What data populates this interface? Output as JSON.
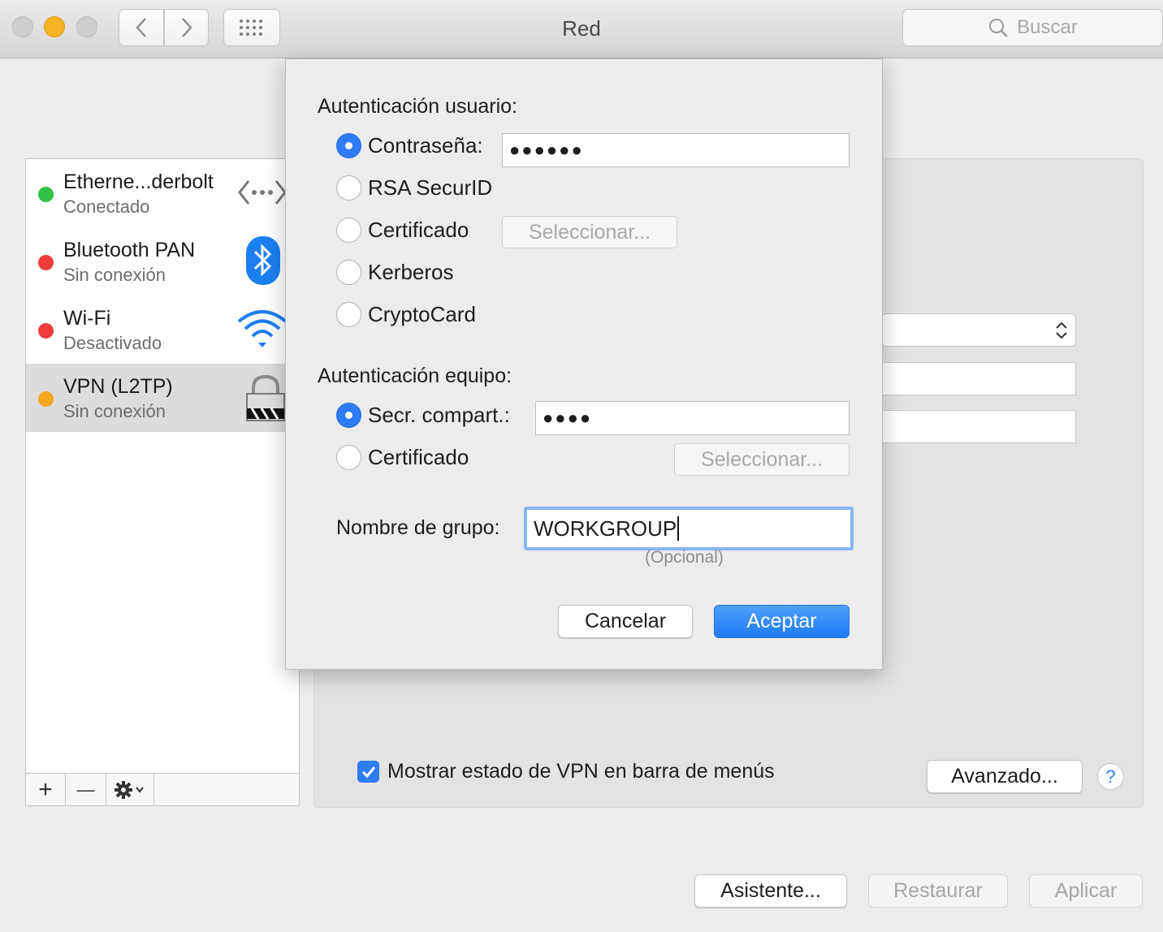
{
  "window": {
    "title": "Red",
    "search_placeholder": "Buscar"
  },
  "services": [
    {
      "name": "Etherne...derbolt",
      "status": "Conectado",
      "status_color": "#2fc145",
      "icon": "ethernet-icon"
    },
    {
      "name": "Bluetooth PAN",
      "status": "Sin conexión",
      "status_color": "#ee3c3c",
      "icon": "bluetooth-icon"
    },
    {
      "name": "Wi-Fi",
      "status": "Desactivado",
      "status_color": "#ee3c3c",
      "icon": "wifi-icon"
    },
    {
      "name": "VPN (L2TP)",
      "status": "Sin conexión",
      "status_color": "#f5a623",
      "icon": "vpn-lock-icon",
      "selected": true
    }
  ],
  "list_toolbar": {
    "add": "+",
    "remove": "—"
  },
  "sheet": {
    "user_auth_title": "Autenticación usuario:",
    "user_auth_options": [
      "Contraseña:",
      "RSA SecurID",
      "Certificado",
      "Kerberos",
      "CryptoCard"
    ],
    "password_value": "●●●●●●",
    "select_label": "Seleccionar...",
    "machine_auth_title": "Autenticación equipo:",
    "machine_auth_options": [
      "Secr. compart.:",
      "Certificado"
    ],
    "shared_secret_value": "●●●●",
    "group_label": "Nombre de grupo:",
    "group_value": "WORKGROUP",
    "group_hint": "(Opcional)",
    "cancel": "Cancelar",
    "accept": "Aceptar"
  },
  "panel": {
    "show_vpn_status": "Mostrar estado de VPN en barra de menús",
    "advanced": "Avanzado...",
    "help": "?"
  },
  "footer": {
    "assistant": "Asistente...",
    "revert": "Restaurar",
    "apply": "Aplicar"
  }
}
